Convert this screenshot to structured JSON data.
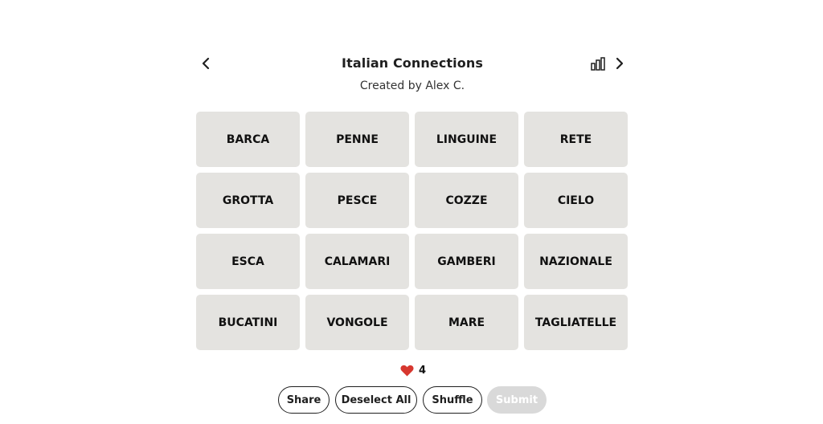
{
  "header": {
    "title": "Italian Connections",
    "subtitle": "Created by Alex C."
  },
  "tiles": [
    {
      "label": "BARCA"
    },
    {
      "label": "PENNE"
    },
    {
      "label": "LINGUINE"
    },
    {
      "label": "RETE"
    },
    {
      "label": "GROTTA"
    },
    {
      "label": "PESCE"
    },
    {
      "label": "COZZE"
    },
    {
      "label": "CIELO"
    },
    {
      "label": "ESCA"
    },
    {
      "label": "CALAMARI"
    },
    {
      "label": "GAMBERI"
    },
    {
      "label": "NAZIONALE"
    },
    {
      "label": "BUCATINI"
    },
    {
      "label": "VONGOLE"
    },
    {
      "label": "MARE"
    },
    {
      "label": "TAGLIATELLE"
    }
  ],
  "lives": {
    "count": "4",
    "icon": "heart-icon",
    "color": "#d7372f"
  },
  "actions": {
    "share": "Share",
    "deselect": "Deselect All",
    "shuffle": "Shuffle",
    "submit": "Submit"
  },
  "colors": {
    "tile_bg": "#e4e3e0",
    "text": "#1f1f1f",
    "submit_disabled_bg": "#d9d9d9"
  }
}
